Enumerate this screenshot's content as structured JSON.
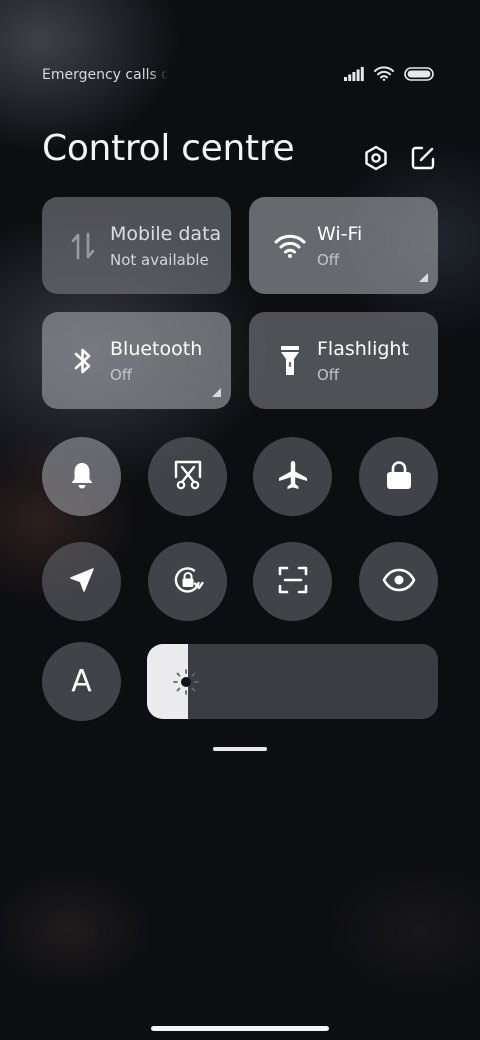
{
  "status_bar": {
    "carrier_text": "Emergency calls only",
    "icons": [
      "signal-icon",
      "wifi-icon",
      "battery-icon"
    ]
  },
  "header": {
    "title": "Control centre",
    "buttons": [
      "settings-icon",
      "edit-icon"
    ]
  },
  "tiles": [
    {
      "id": "mobile-data",
      "label": "Mobile data",
      "status": "Not available",
      "icon": "mobile-data-icon",
      "active": false
    },
    {
      "id": "wifi",
      "label": "Wi-Fi",
      "status": "Off",
      "icon": "wifi-icon",
      "active": true
    },
    {
      "id": "bluetooth",
      "label": "Bluetooth",
      "status": "Off",
      "icon": "bluetooth-icon",
      "active": true
    },
    {
      "id": "flashlight",
      "label": "Flashlight",
      "status": "Off",
      "icon": "flashlight-icon",
      "active": false
    }
  ],
  "toggles_row1": [
    "bell-icon",
    "screenshot-icon",
    "airplane-icon",
    "lock-icon"
  ],
  "toggles_row2": [
    "location-icon",
    "rotation-lock-icon",
    "scan-icon",
    "eye-icon"
  ],
  "auto_brightness": {
    "label": "A"
  },
  "brightness": {
    "level_fraction": 0.14
  },
  "colors": {
    "background": "#0d0e12",
    "tile": "#7a7c82",
    "slider_track": "#3c3d42",
    "slider_fill": "#ececee"
  }
}
